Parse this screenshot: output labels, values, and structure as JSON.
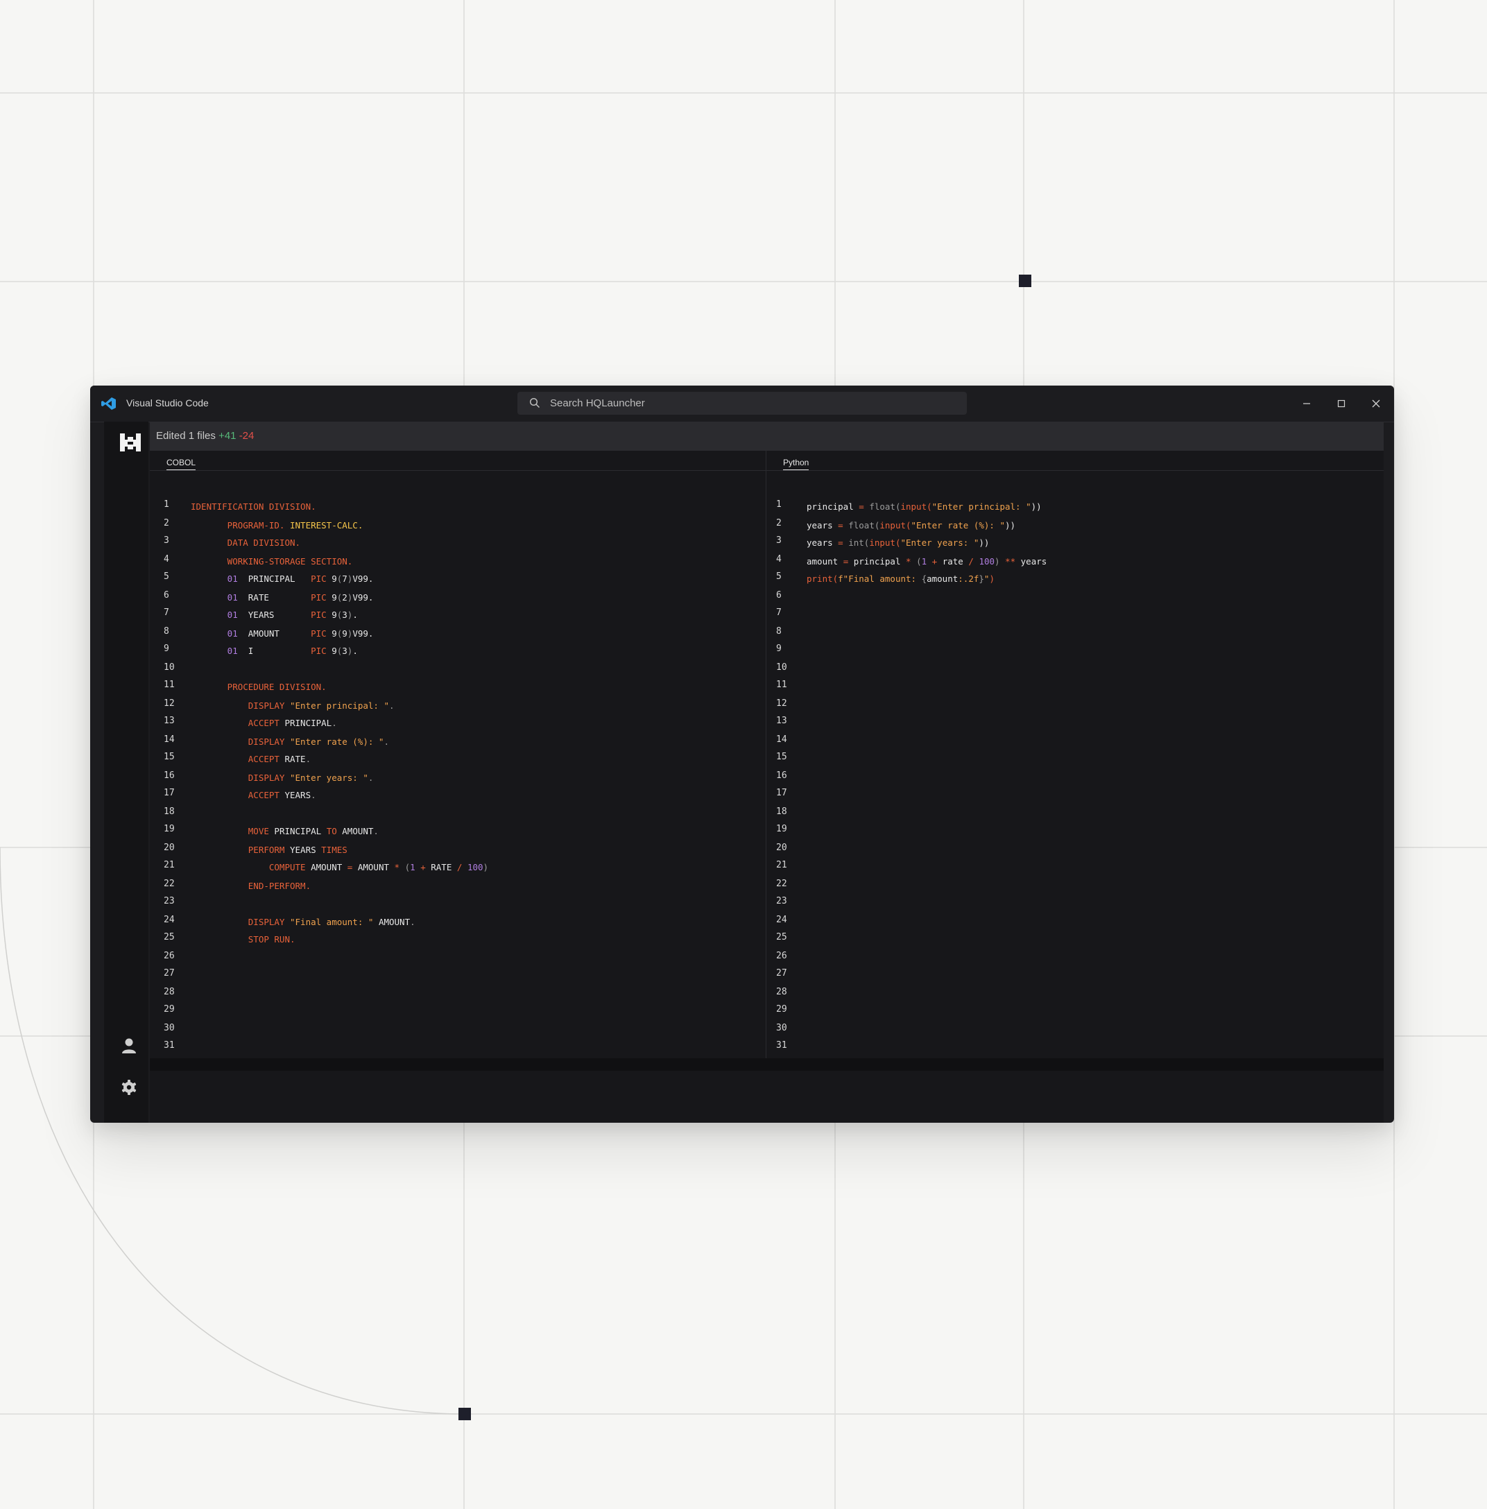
{
  "window": {
    "title": "Visual Studio Code",
    "search_placeholder": "Search HQLauncher"
  },
  "edited": {
    "text": "Edited 1 files",
    "plus": "+41",
    "minus": "-24"
  },
  "tabs": {
    "left": "COBOL",
    "right": "Python"
  },
  "line_count": 32,
  "cobol": [
    [
      [
        "k",
        "IDENTIFICATION DIVISION."
      ]
    ],
    [
      [
        "k",
        "       PROGRAM-ID. "
      ],
      [
        "y",
        "INTEREST-CALC."
      ]
    ],
    [
      [
        "k",
        "       DATA DIVISION."
      ]
    ],
    [
      [
        "k",
        "       WORKING-STORAGE SECTION."
      ]
    ],
    [
      [
        "p",
        "       01"
      ],
      [
        "n",
        "  PRINCIPAL   "
      ],
      [
        "k",
        "PIC "
      ],
      [
        "n",
        "9"
      ],
      [
        "f",
        "("
      ],
      [
        "n",
        "7"
      ],
      [
        "f",
        ")"
      ],
      [
        "n",
        "V99."
      ]
    ],
    [
      [
        "p",
        "       01"
      ],
      [
        "n",
        "  RATE        "
      ],
      [
        "k",
        "PIC "
      ],
      [
        "n",
        "9"
      ],
      [
        "f",
        "("
      ],
      [
        "n",
        "2"
      ],
      [
        "f",
        ")"
      ],
      [
        "n",
        "V99."
      ]
    ],
    [
      [
        "p",
        "       01"
      ],
      [
        "n",
        "  YEARS       "
      ],
      [
        "k",
        "PIC "
      ],
      [
        "n",
        "9"
      ],
      [
        "f",
        "("
      ],
      [
        "n",
        "3"
      ],
      [
        "f",
        ")"
      ],
      [
        "n",
        "."
      ]
    ],
    [
      [
        "p",
        "       01"
      ],
      [
        "n",
        "  AMOUNT      "
      ],
      [
        "k",
        "PIC "
      ],
      [
        "n",
        "9"
      ],
      [
        "f",
        "("
      ],
      [
        "n",
        "9"
      ],
      [
        "f",
        ")"
      ],
      [
        "n",
        "V99."
      ]
    ],
    [
      [
        "p",
        "       01"
      ],
      [
        "n",
        "  I           "
      ],
      [
        "k",
        "PIC "
      ],
      [
        "n",
        "9"
      ],
      [
        "f",
        "("
      ],
      [
        "n",
        "3"
      ],
      [
        "f",
        ")"
      ],
      [
        "n",
        "."
      ]
    ],
    [],
    [
      [
        "k",
        "       PROCEDURE DIVISION."
      ]
    ],
    [
      [
        "k",
        "           DISPLAY "
      ],
      [
        "s",
        "\"Enter principal: \""
      ],
      [
        "f",
        "."
      ]
    ],
    [
      [
        "k",
        "           ACCEPT "
      ],
      [
        "n",
        "PRINCIPAL"
      ],
      [
        "f",
        "."
      ]
    ],
    [
      [
        "k",
        "           DISPLAY "
      ],
      [
        "s",
        "\"Enter rate (%): \""
      ],
      [
        "f",
        "."
      ]
    ],
    [
      [
        "k",
        "           ACCEPT "
      ],
      [
        "n",
        "RATE"
      ],
      [
        "f",
        "."
      ]
    ],
    [
      [
        "k",
        "           DISPLAY "
      ],
      [
        "s",
        "\"Enter years: \""
      ],
      [
        "f",
        "."
      ]
    ],
    [
      [
        "k",
        "           ACCEPT "
      ],
      [
        "n",
        "YEARS"
      ],
      [
        "f",
        "."
      ]
    ],
    [],
    [
      [
        "k",
        "           MOVE "
      ],
      [
        "n",
        "PRINCIPAL "
      ],
      [
        "k",
        "TO "
      ],
      [
        "n",
        "AMOUNT"
      ],
      [
        "f",
        "."
      ]
    ],
    [
      [
        "k",
        "           PERFORM "
      ],
      [
        "n",
        "YEARS "
      ],
      [
        "k",
        "TIMES"
      ]
    ],
    [
      [
        "k",
        "               COMPUTE "
      ],
      [
        "n",
        "AMOUNT "
      ],
      [
        "k",
        "= "
      ],
      [
        "n",
        "AMOUNT "
      ],
      [
        "k",
        "* "
      ],
      [
        "f",
        "("
      ],
      [
        "p",
        "1 "
      ],
      [
        "k",
        "+ "
      ],
      [
        "n",
        "RATE "
      ],
      [
        "k",
        "/ "
      ],
      [
        "p",
        "100"
      ],
      [
        "f",
        ")"
      ]
    ],
    [
      [
        "k",
        "           END-PERFORM."
      ]
    ],
    [],
    [
      [
        "k",
        "           DISPLAY "
      ],
      [
        "s",
        "\"Final amount: \" "
      ],
      [
        "n",
        "AMOUNT"
      ],
      [
        "f",
        "."
      ]
    ],
    [
      [
        "k",
        "           STOP RUN."
      ]
    ]
  ],
  "python": [
    [
      [
        "n",
        "principal "
      ],
      [
        "k",
        "= "
      ],
      [
        "f",
        "float("
      ],
      [
        "k",
        "input("
      ],
      [
        "s",
        "\"Enter principal: \""
      ],
      [
        "n",
        "))"
      ]
    ],
    [
      [
        "n",
        "years "
      ],
      [
        "k",
        "= "
      ],
      [
        "f",
        "float("
      ],
      [
        "k",
        "input("
      ],
      [
        "s",
        "\"Enter rate (%): \""
      ],
      [
        "n",
        "))"
      ]
    ],
    [
      [
        "n",
        "years "
      ],
      [
        "k",
        "= "
      ],
      [
        "f",
        "int("
      ],
      [
        "k",
        "input("
      ],
      [
        "s",
        "\"Enter years: \""
      ],
      [
        "n",
        "))"
      ]
    ],
    [
      [
        "n",
        "amount "
      ],
      [
        "k",
        "= "
      ],
      [
        "n",
        "principal "
      ],
      [
        "k",
        "* "
      ],
      [
        "f",
        "("
      ],
      [
        "p",
        "1 "
      ],
      [
        "k",
        "+ "
      ],
      [
        "n",
        "rate "
      ],
      [
        "k",
        "/ "
      ],
      [
        "p",
        "100"
      ],
      [
        "f",
        ") "
      ],
      [
        "k",
        "** "
      ],
      [
        "n",
        "years"
      ]
    ],
    [
      [
        "k",
        "print("
      ],
      [
        "s",
        "f\"Final amount: "
      ],
      [
        "f",
        "{"
      ],
      [
        "n",
        "amount"
      ],
      [
        "s",
        ":.2f"
      ],
      [
        "f",
        "}"
      ],
      [
        "s",
        "\""
      ],
      [
        "k",
        ")"
      ]
    ]
  ]
}
